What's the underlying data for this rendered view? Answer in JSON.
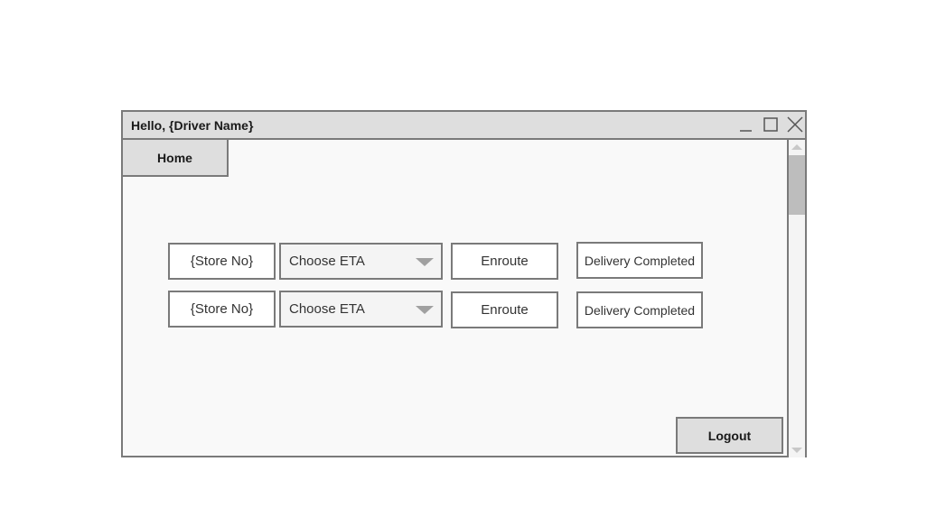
{
  "window": {
    "title": "Hello, {Driver Name}"
  },
  "tabs": [
    {
      "label": "Home"
    }
  ],
  "rows": [
    {
      "store": "{Store No}",
      "eta": "Choose ETA",
      "enroute": "Enroute",
      "delivered": "Delivery Completed"
    },
    {
      "store": "{Store No}",
      "eta": "Choose ETA",
      "enroute": "Enroute",
      "delivered": "Delivery Completed"
    }
  ],
  "footer": {
    "logout_label": "Logout"
  },
  "icons": {
    "minimize": "minimize-icon",
    "maximize": "maximize-icon",
    "close": "close-icon",
    "dropdown": "chevron-down-icon"
  },
  "colors": {
    "border": "#7a7a7a",
    "chrome": "#dedede",
    "content_bg": "#f9f9f9"
  }
}
